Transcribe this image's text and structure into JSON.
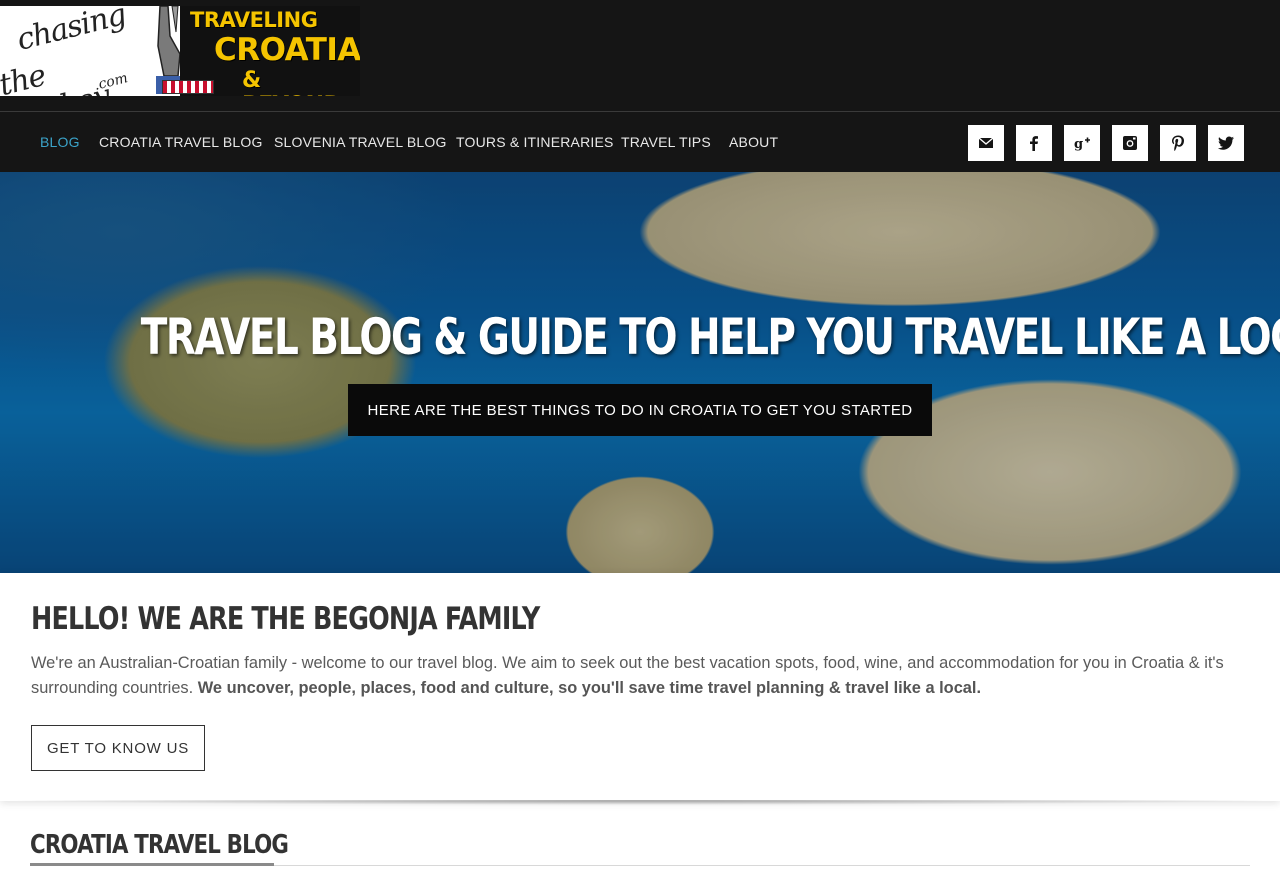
{
  "logo": {
    "script_line1": "chasing",
    "script_line2": "the donkey",
    "script_line3": ".com",
    "banner_line1": "TRAVELING",
    "banner_line2": "CROATIA",
    "banner_line3": "& BEYOND..."
  },
  "nav": {
    "items": [
      {
        "label": "BLOG",
        "active": true
      },
      {
        "label": "CROATIA TRAVEL BLOG",
        "active": false
      },
      {
        "label": "SLOVENIA TRAVEL BLOG",
        "active": false
      },
      {
        "label": "TOURS & ITINERARIES",
        "active": false
      },
      {
        "label": "TRAVEL TIPS",
        "active": false
      },
      {
        "label": "ABOUT",
        "active": false
      }
    ],
    "social": [
      "email-icon",
      "facebook-icon",
      "google-plus-icon",
      "instagram-icon",
      "pinterest-icon",
      "twitter-icon"
    ],
    "active_color": "#3ba3c9"
  },
  "hero": {
    "title": "TRAVEL BLOG & GUIDE TO HELP YOU TRAVEL LIKE A LOCAL",
    "button_label": "HERE ARE THE BEST THINGS TO DO IN CROATIA TO GET YOU STARTED"
  },
  "intro": {
    "title": "HELLO! WE ARE THE BEGONJA FAMILY",
    "text": "We're an Australian-Croatian family - welcome to our travel blog. We aim to seek out the best vacation spots, food, wine, and accommodation for you in Croatia & it's surrounding countries. ",
    "text_bold": "We uncover, people, places, food and culture, so you'll save time travel planning & travel like a local.",
    "button_label": "GET TO KNOW US"
  },
  "section": {
    "title": "CROATIA TRAVEL BLOG"
  }
}
